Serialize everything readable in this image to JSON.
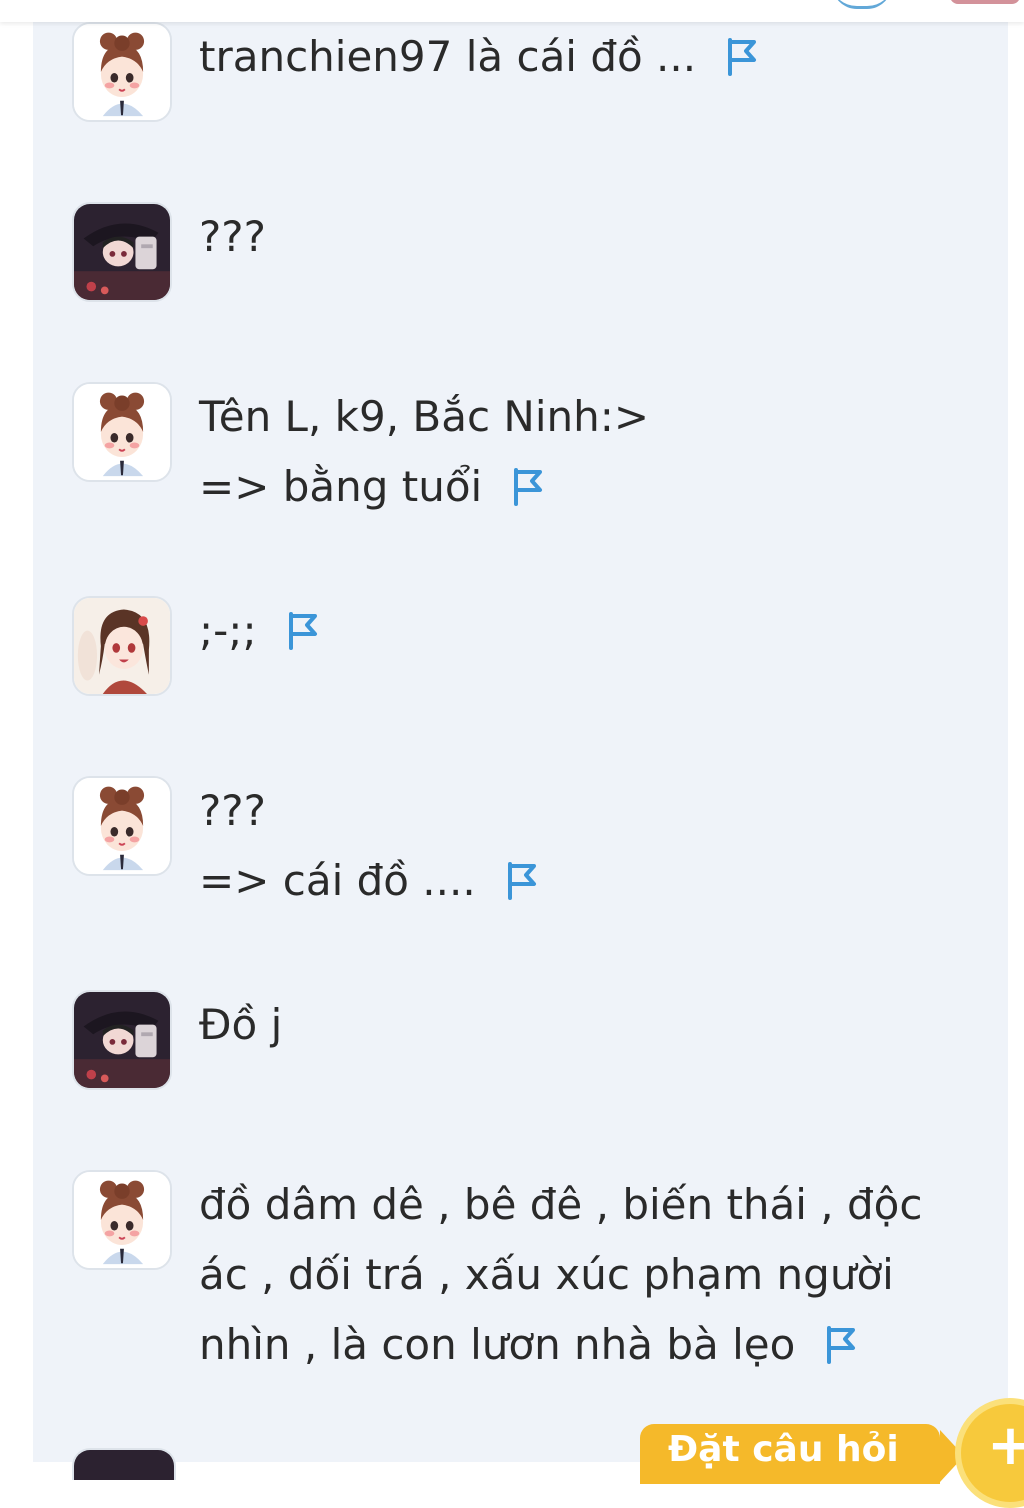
{
  "colors": {
    "panel_bg": "#eff3f9",
    "text": "#2a2a2a",
    "flag": "#3b95d8",
    "ask_button": "#f5b92a"
  },
  "icons": {
    "flag": "report-flag-icon",
    "plus": "plus-icon"
  },
  "comments": [
    {
      "avatar": "avatar-girl-bun",
      "lines": [
        "tranchien97 là cái đồ ..."
      ],
      "flag": true
    },
    {
      "avatar": "avatar-dark-hat",
      "lines": [
        "???"
      ],
      "flag": false
    },
    {
      "avatar": "avatar-girl-bun",
      "lines": [
        "Tên L, k9, Bắc Ninh:>",
        "=> bằng tuổi"
      ],
      "flag": true
    },
    {
      "avatar": "avatar-girl-red",
      "lines": [
        ";-;;"
      ],
      "flag": true
    },
    {
      "avatar": "avatar-girl-bun",
      "lines": [
        "???",
        "=> cái đồ ...."
      ],
      "flag": true
    },
    {
      "avatar": "avatar-dark-hat",
      "lines": [
        "Đồ j"
      ],
      "flag": false
    },
    {
      "avatar": "avatar-girl-bun",
      "lines": [
        "đồ dâm dê , bê đê , biến thái , độc",
        "ác , dối trá , xấu xúc phạm người",
        "nhìn , là con lươn nhà bà lẹo"
      ],
      "flag": true
    }
  ],
  "ask_button": {
    "label": "Đặt câu hỏi",
    "plus": "+"
  }
}
